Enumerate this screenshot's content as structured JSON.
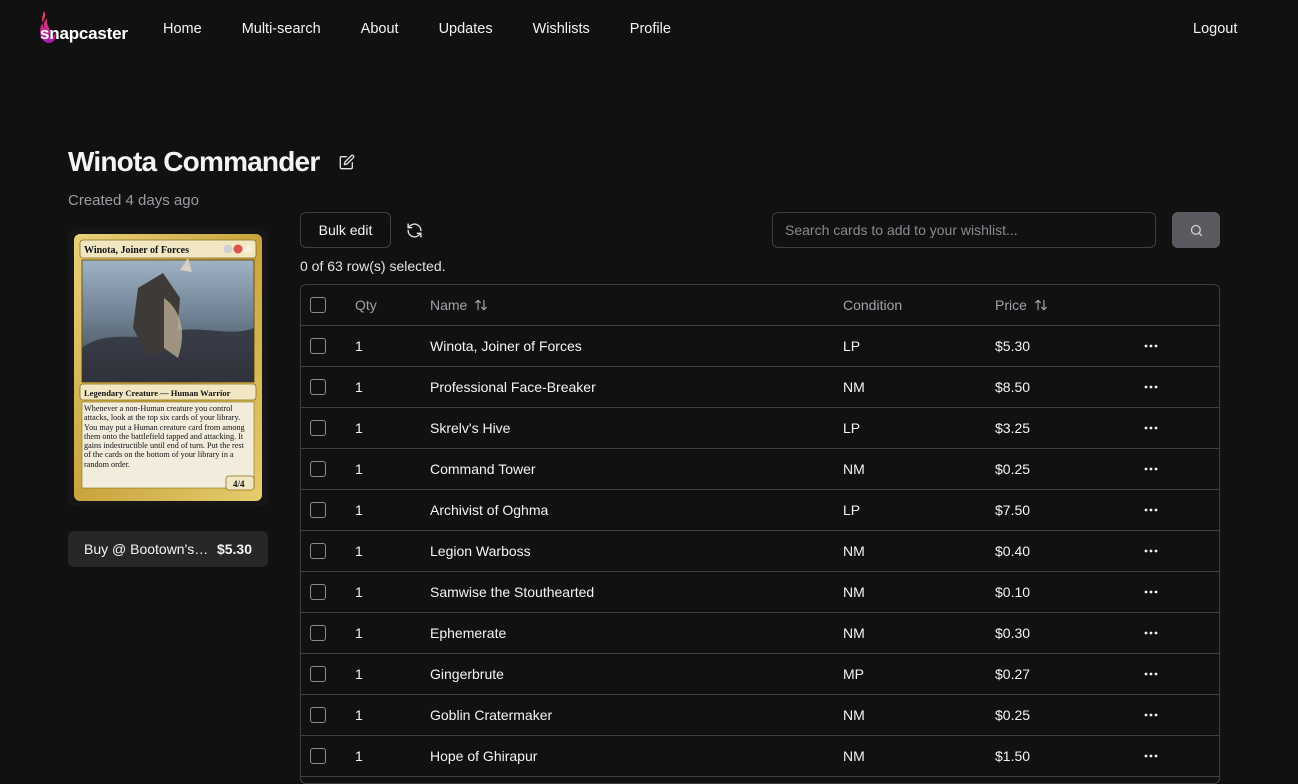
{
  "app": {
    "logo_text": "snapcaster"
  },
  "nav": {
    "items": [
      {
        "label": "Home"
      },
      {
        "label": "Multi-search"
      },
      {
        "label": "About"
      },
      {
        "label": "Updates"
      },
      {
        "label": "Wishlists"
      },
      {
        "label": "Profile"
      }
    ],
    "logout_label": "Logout"
  },
  "wishlist": {
    "title": "Winota Commander",
    "created": "Created 4 days ago"
  },
  "card_preview": {
    "name": "Winota, Joiner of Forces",
    "type_line": "Legendary Creature — Human Warrior",
    "rules_text": "Whenever a non-Human creature you control attacks, look at the top six cards of your library. You may put a Human creature card from among them onto the battlefield tapped and attacking. It gains indestructible until end of turn. Put the rest of the cards on the bottom of your library in a random order.",
    "pt": "4/4",
    "buy_label": "Buy @ Bootown's Games",
    "buy_price": "$5.30"
  },
  "toolbar": {
    "bulk_edit_label": "Bulk edit",
    "search_placeholder": "Search cards to add to your wishlist...",
    "selected_text": "0 of 63 row(s) selected."
  },
  "table": {
    "columns": {
      "qty": "Qty",
      "name": "Name",
      "condition": "Condition",
      "price": "Price"
    },
    "rows": [
      {
        "qty": "1",
        "name": "Winota, Joiner of Forces",
        "condition": "LP",
        "price": "$5.30"
      },
      {
        "qty": "1",
        "name": "Professional Face-Breaker",
        "condition": "NM",
        "price": "$8.50"
      },
      {
        "qty": "1",
        "name": "Skrelv's Hive",
        "condition": "LP",
        "price": "$3.25"
      },
      {
        "qty": "1",
        "name": "Command Tower",
        "condition": "NM",
        "price": "$0.25"
      },
      {
        "qty": "1",
        "name": "Archivist of Oghma",
        "condition": "LP",
        "price": "$7.50"
      },
      {
        "qty": "1",
        "name": "Legion Warboss",
        "condition": "NM",
        "price": "$0.40"
      },
      {
        "qty": "1",
        "name": "Samwise the Stouthearted",
        "condition": "NM",
        "price": "$0.10"
      },
      {
        "qty": "1",
        "name": "Ephemerate",
        "condition": "NM",
        "price": "$0.30"
      },
      {
        "qty": "1",
        "name": "Gingerbrute",
        "condition": "MP",
        "price": "$0.27"
      },
      {
        "qty": "1",
        "name": "Goblin Cratermaker",
        "condition": "NM",
        "price": "$0.25"
      },
      {
        "qty": "1",
        "name": "Hope of Ghirapur",
        "condition": "NM",
        "price": "$1.50"
      }
    ]
  },
  "colors": {
    "background": "#111111",
    "border": "#3f3f46",
    "muted_text": "#9b9ba3",
    "logo_flame": "#c026d3"
  }
}
